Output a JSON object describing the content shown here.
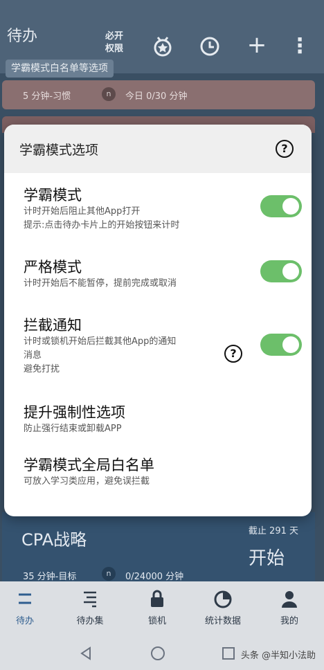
{
  "app": {
    "title": "待办",
    "whitelist_chip": "学霸模式白名单等选项",
    "permission_label": "必开权限",
    "icons": [
      "medal-icon",
      "clock-icon",
      "plus-icon",
      "more-icon"
    ],
    "plus_glyph": "+",
    "more_glyph": "⋮"
  },
  "habit_card": {
    "info": "5 分钟-习惯",
    "counter_icon": "n",
    "today": "今日 0/30 分钟"
  },
  "goal_card": {
    "name": "CPA战略",
    "deadline": "截止 291 天",
    "start_label": "开始",
    "info": "35 分钟-目标",
    "counter_icon": "n",
    "progress": "0/24000 分钟"
  },
  "dialog": {
    "title": "学霸模式选项",
    "help_glyph": "?",
    "options": [
      {
        "title": "学霸模式",
        "desc": [
          "计时开始后阻止其他App打开",
          "提示:点击待办卡片上的开始按钮来计时"
        ],
        "toggle": true
      },
      {
        "title": "严格模式",
        "desc": [
          "计时开始后不能暂停，提前完成或取消"
        ],
        "toggle": true
      },
      {
        "title": "拦截通知",
        "desc": [
          "计时或锁机开始后拦截其他App的通知",
          "消息",
          "避免打扰"
        ],
        "toggle": true,
        "help": true
      },
      {
        "title": "提升强制性选项",
        "desc": [
          "防止强行结束或卸载APP"
        ]
      },
      {
        "title": "学霸模式全局白名单",
        "desc": [
          "可放入学习类应用，避免误拦截"
        ]
      }
    ],
    "toggle_color": "#6cbf6a"
  },
  "bottom_nav": [
    {
      "label": "待办",
      "icon": "todo-icon",
      "active": true
    },
    {
      "label": "待办集",
      "icon": "todo-set-icon",
      "active": false
    },
    {
      "label": "锁机",
      "icon": "lock-icon",
      "active": false
    },
    {
      "label": "统计数据",
      "icon": "pie-chart-icon",
      "active": false
    },
    {
      "label": "我的",
      "icon": "person-icon",
      "active": false
    }
  ],
  "watermark": "头条 @半知小法助"
}
